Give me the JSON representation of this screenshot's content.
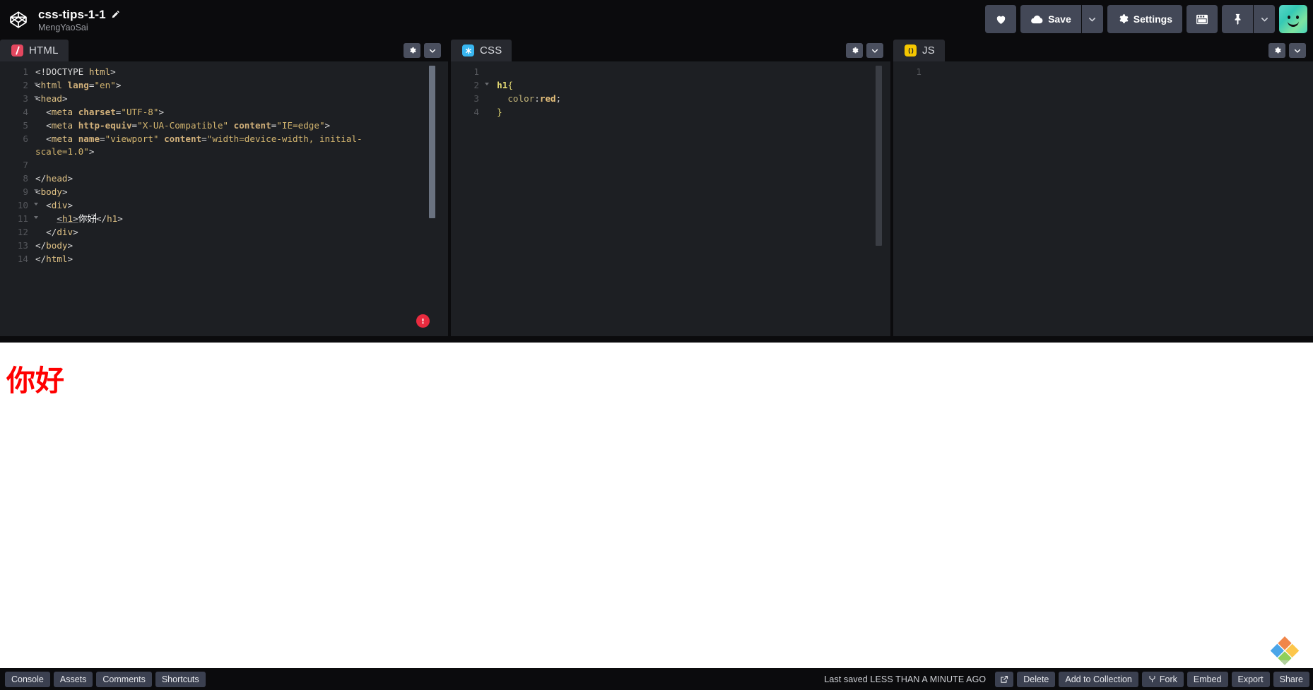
{
  "app": {
    "logo_icon": "codepen-cube-icon",
    "pen_title": "css-tips-1-1",
    "pen_title_edit_icon": "pencil-icon",
    "pen_author": "MengYaoSai"
  },
  "toolbar": {
    "love_label": "",
    "love_icon": "heart-icon",
    "save_label": "Save",
    "save_icon": "cloud-icon",
    "save_caret_icon": "chevron-down-icon",
    "settings_label": "Settings",
    "settings_icon": "gear-icon",
    "layout_icon": "layout-grid-icon",
    "pin_icon": "pin-icon",
    "pin_caret_icon": "chevron-down-icon",
    "avatar_icon": "user-avatar"
  },
  "editors": [
    {
      "id": "html",
      "label": "HTML",
      "lang_icon": "html-slash-icon",
      "settings_icon": "gear-icon",
      "collapse_icon": "chevron-down-icon",
      "has_error": true,
      "error_icon": "error-exclamation-icon",
      "lines": [
        {
          "num": "1",
          "fold": false,
          "html": "<span class=\"t-punct\">&lt;!DOCTYPE </span><span class=\"t-tag\">html</span><span class=\"t-punct\">&gt;</span>"
        },
        {
          "num": "2",
          "fold": true,
          "html": "<span class=\"t-punct\">&lt;</span><span class=\"t-tag\">html</span> <span class=\"t-attr\">lang</span><span class=\"t-punct\">=</span><span class=\"t-str\">\"en\"</span><span class=\"t-punct\">&gt;</span>"
        },
        {
          "num": "3",
          "fold": true,
          "html": "<span class=\"t-punct\">&lt;</span><span class=\"t-tag\">head</span><span class=\"t-punct\">&gt;</span>"
        },
        {
          "num": "4",
          "fold": false,
          "html": "  <span class=\"t-punct\">&lt;</span><span class=\"t-tag\">meta</span> <span class=\"t-attr\">charset</span><span class=\"t-punct\">=</span><span class=\"t-str\">\"UTF-8\"</span><span class=\"t-punct\">&gt;</span>"
        },
        {
          "num": "5",
          "fold": false,
          "html": "  <span class=\"t-punct\">&lt;</span><span class=\"t-tag\">meta</span> <span class=\"t-attr\">http-equiv</span><span class=\"t-punct\">=</span><span class=\"t-str\">\"X-UA-Compatible\"</span> <span class=\"t-attr\">content</span><span class=\"t-punct\">=</span><span class=\"t-str\">\"IE=edge\"</span><span class=\"t-punct\">&gt;</span>"
        },
        {
          "num": "6",
          "fold": false,
          "html": "  <span class=\"t-punct\">&lt;</span><span class=\"t-tag\">meta</span> <span class=\"t-attr\">name</span><span class=\"t-punct\">=</span><span class=\"t-str\">\"viewport\"</span> <span class=\"t-attr\">content</span><span class=\"t-punct\">=</span><span class=\"t-str\">\"width=device-width, initial-</span>"
        },
        {
          "num": "",
          "fold": false,
          "html": "<span class=\"t-str\">scale=1.0\"</span><span class=\"t-punct\">&gt;</span>"
        },
        {
          "num": "7",
          "fold": false,
          "html": ""
        },
        {
          "num": "8",
          "fold": false,
          "html": "<span class=\"t-punct\">&lt;/</span><span class=\"t-tag\">head</span><span class=\"t-punct\">&gt;</span>"
        },
        {
          "num": "9",
          "fold": true,
          "html": "<span class=\"t-punct\">&lt;</span><span class=\"t-tag\">body</span><span class=\"t-punct\">&gt;</span>"
        },
        {
          "num": "10",
          "fold": true,
          "html": "  <span class=\"t-punct\">&lt;</span><span class=\"t-tag\">div</span><span class=\"t-punct\">&gt;</span>"
        },
        {
          "num": "11",
          "fold": true,
          "html": "    <span class=\"t-punct t-hover\">&lt;</span><span class=\"t-tag t-hover\">h1</span><span class=\"t-punct t-hover\">&gt;</span><span class=\"t-txt\">你好</span><span class=\"caret\"></span><span class=\"t-punct\">&lt;/</span><span class=\"t-tag\">h1</span><span class=\"t-punct\">&gt;</span>"
        },
        {
          "num": "12",
          "fold": false,
          "html": "  <span class=\"t-punct\">&lt;/</span><span class=\"t-tag\">div</span><span class=\"t-punct\">&gt;</span>"
        },
        {
          "num": "13",
          "fold": false,
          "html": "<span class=\"t-punct\">&lt;/</span><span class=\"t-tag\">body</span><span class=\"t-punct\">&gt;</span>"
        },
        {
          "num": "14",
          "fold": false,
          "html": "<span class=\"t-punct\">&lt;/</span><span class=\"t-tag\">html</span><span class=\"t-punct\">&gt;</span>"
        }
      ],
      "plain_code": "<!DOCTYPE html>\n<html lang=\"en\">\n<head>\n  <meta charset=\"UTF-8\">\n  <meta http-equiv=\"X-UA-Compatible\" content=\"IE=edge\">\n  <meta name=\"viewport\" content=\"width=device-width, initial-scale=1.0\">\n\n</head>\n<body>\n  <div>\n    <h1>你好</h1>\n  </div>\n</body>\n</html>"
    },
    {
      "id": "css",
      "label": "CSS",
      "lang_icon": "css-asterisk-icon",
      "settings_icon": "gear-icon",
      "collapse_icon": "chevron-down-icon",
      "has_error": false,
      "lines": [
        {
          "num": "1",
          "fold": false,
          "html": ""
        },
        {
          "num": "2",
          "fold": true,
          "html": "  <span class=\"t-sel\">h1</span><span class=\"t-brace\">{</span>"
        },
        {
          "num": "3",
          "fold": false,
          "html": "    <span class=\"t-prop\">color</span><span class=\"t-punct\">:</span><span class=\"t-val\">red</span><span class=\"t-punct\">;</span>"
        },
        {
          "num": "4",
          "fold": false,
          "html": "  <span class=\"t-brace\">}</span>"
        }
      ],
      "plain_code": "\n  h1{\n    color:red;\n  }"
    },
    {
      "id": "js",
      "label": "JS",
      "lang_icon": "js-parens-icon",
      "settings_icon": "gear-icon",
      "collapse_icon": "chevron-down-icon",
      "has_error": false,
      "lines": [
        {
          "num": "1",
          "fold": false,
          "html": ""
        }
      ],
      "plain_code": ""
    }
  ],
  "preview": {
    "heading": "你好",
    "heading_color": "#ff0000",
    "background": "#ffffff"
  },
  "ime": {
    "icon": "ime-pinwheel-icon"
  },
  "bottombar": {
    "left_buttons": [
      {
        "label": "Console"
      },
      {
        "label": "Assets"
      },
      {
        "label": "Comments"
      },
      {
        "label": "Shortcuts"
      }
    ],
    "saved_status": "Last saved LESS THAN A MINUTE AGO",
    "open_external_icon": "external-link-icon",
    "right_buttons": [
      {
        "label": "Delete",
        "icon": ""
      },
      {
        "label": "Add to Collection",
        "icon": ""
      },
      {
        "label": "Fork",
        "icon": "fork-icon"
      },
      {
        "label": "Embed",
        "icon": ""
      },
      {
        "label": "Export",
        "icon": ""
      },
      {
        "label": "Share",
        "icon": ""
      }
    ]
  },
  "colors": {
    "chrome_bg": "#0b0b0d",
    "editor_bg": "#1d1f23",
    "tab_bg": "#27292f",
    "button_bg": "#434857",
    "accent_html": "#e4475f",
    "accent_css": "#38b6f0",
    "accent_js": "#f5c700",
    "error_red": "#ea2b3f"
  }
}
